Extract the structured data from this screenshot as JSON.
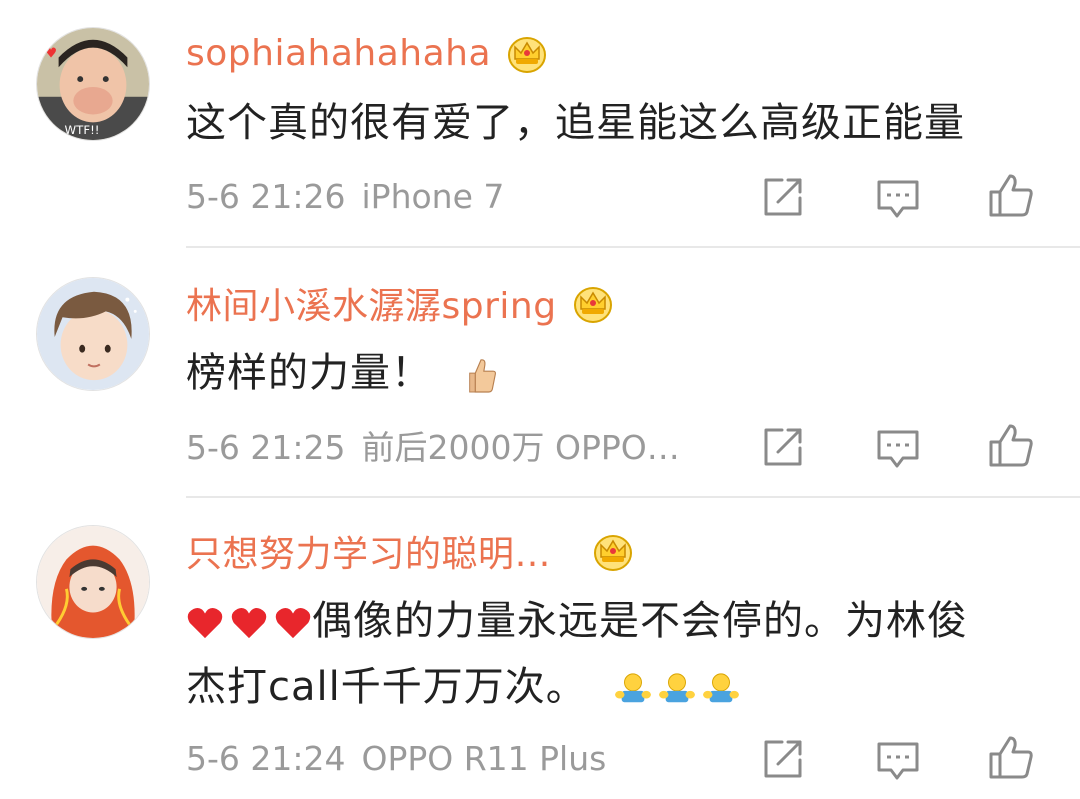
{
  "comments": [
    {
      "username": "sophiahahahaha",
      "text": "这个真的很有爱了，追星能这么高级正能量",
      "time": "5-6 21:26",
      "device": "iPhone 7"
    },
    {
      "username": "林间小溪水潺潺spring",
      "text": "榜样的力量！",
      "time": "5-6 21:25",
      "device": "前后2000万 OPPO…"
    },
    {
      "username": "只想努力学习的聪明…",
      "text_line1": "偶像的力量永远是不会停的。为林俊",
      "text_line2": "杰打call千千万万次。",
      "time": "5-6 21:24",
      "device": "OPPO R11 Plus"
    }
  ],
  "icons": {
    "badge": "crown-icon",
    "repost": "repost-icon",
    "comment": "comment-icon",
    "like": "thumbs-up-icon"
  },
  "colors": {
    "username": "#eb7350",
    "meta": "#9a9a9a",
    "icon": "#8a8a8a"
  }
}
